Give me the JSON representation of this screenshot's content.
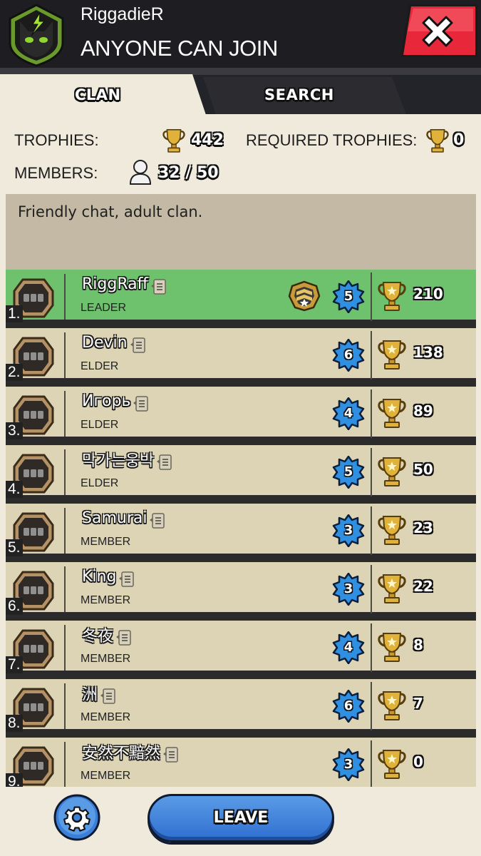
{
  "header": {
    "owner_name": "RiggadieR",
    "join_status": "ANYONE CAN JOIN",
    "clan_badge_icon": "green-lightning-cat-badge-icon",
    "close_icon": "close-icon"
  },
  "tabs": [
    {
      "label": "CLAN",
      "active": true
    },
    {
      "label": "SEARCH",
      "active": false
    }
  ],
  "info": {
    "trophies_label": "TROPHIES:",
    "trophies_value": "442",
    "required_label": "REQUIRED TROPHIES:",
    "required_value": "0",
    "members_label": "MEMBERS:",
    "members_value": "32 / 50"
  },
  "description": "Friendly chat, adult clan.",
  "members": [
    {
      "rank": "1.",
      "name": "RiggRaff",
      "role": "LEADER",
      "level": "5",
      "trophies": "210"
    },
    {
      "rank": "2.",
      "name": "Devin",
      "role": "ELDER",
      "level": "6",
      "trophies": "138"
    },
    {
      "rank": "3.",
      "name": "Игорь",
      "role": "ELDER",
      "level": "4",
      "trophies": "89"
    },
    {
      "rank": "4.",
      "name": "막가는웅박",
      "role": "ELDER",
      "level": "5",
      "trophies": "50"
    },
    {
      "rank": "5.",
      "name": "Samurai",
      "role": "MEMBER",
      "level": "3",
      "trophies": "23"
    },
    {
      "rank": "6.",
      "name": "King",
      "role": "MEMBER",
      "level": "3",
      "trophies": "22"
    },
    {
      "rank": "7.",
      "name": "冬夜",
      "role": "MEMBER",
      "level": "4",
      "trophies": "8"
    },
    {
      "rank": "8.",
      "name": "洲",
      "role": "MEMBER",
      "level": "6",
      "trophies": "7"
    },
    {
      "rank": "9.",
      "name": "安然不黯然",
      "role": "MEMBER",
      "level": "3",
      "trophies": "0"
    }
  ],
  "footer": {
    "settings_icon": "gear-icon",
    "leave_label": "LEAVE"
  },
  "colors": {
    "header_bg": "#1e1e22",
    "panel_bg": "#efeadb",
    "row_bg": "#dcd4b5",
    "leader_row_bg": "#6ec16d",
    "description_bg": "#c3b9a5",
    "close_red": "#e8283a",
    "level_blue": "#2f8fe0",
    "leave_blue": "#3b7fd8"
  }
}
